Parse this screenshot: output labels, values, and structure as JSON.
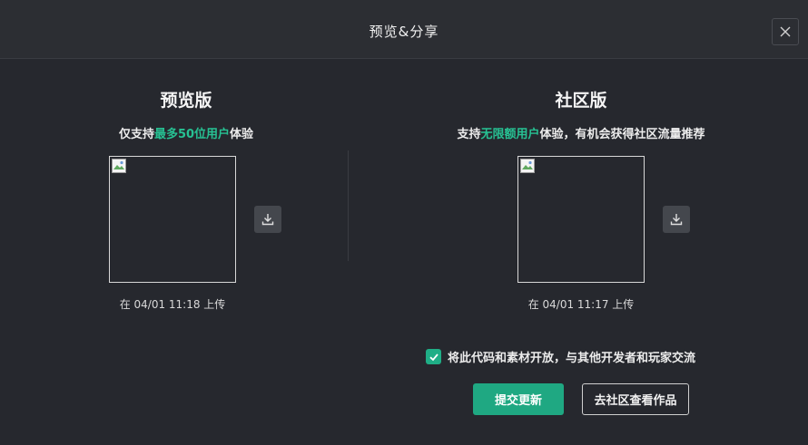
{
  "dialog": {
    "title": "预览&分享"
  },
  "preview": {
    "heading": "预览版",
    "subtitle_prefix": "仅支持",
    "subtitle_highlight": "最多50位用户",
    "subtitle_suffix": "体验",
    "upload_time": "在 04/01 11:18 上传"
  },
  "community": {
    "heading": "社区版",
    "subtitle_prefix": "支持",
    "subtitle_highlight": "无限额用户",
    "subtitle_suffix": "体验，有机会获得社区流量推荐",
    "upload_time": "在 04/01 11:17 上传"
  },
  "open_source": {
    "label": "将此代码和素材开放，与其他开发者和玩家交流",
    "checked": true
  },
  "buttons": {
    "submit": "提交更新",
    "view_community": "去社区查看作品"
  },
  "colors": {
    "accent": "#1fa882",
    "highlight": "#27c193",
    "background": "#26282e"
  }
}
